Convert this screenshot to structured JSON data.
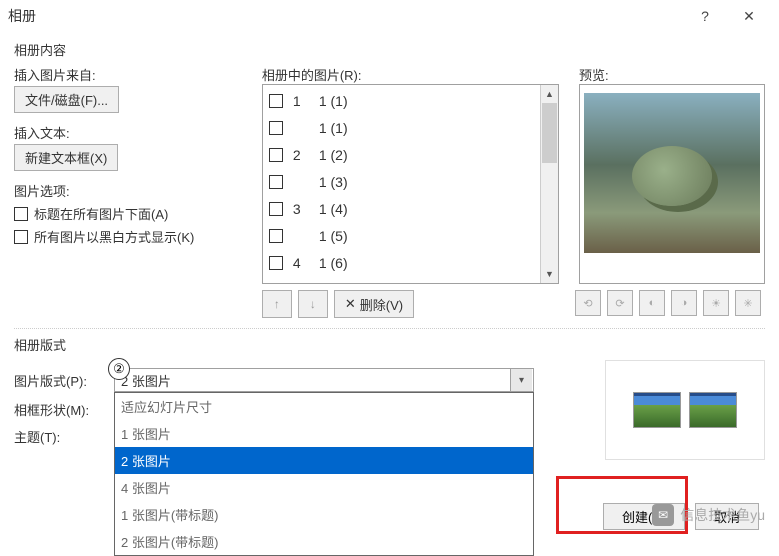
{
  "title": "相册",
  "help": "?",
  "close": "✕",
  "sections": {
    "content": "相册内容",
    "insert_from": "插入图片来自:",
    "file_disk": "文件/磁盘(F)...",
    "insert_text": "插入文本:",
    "new_textbox": "新建文本框(X)",
    "pic_options": "图片选项:",
    "opt_caption": "标题在所有图片下面(A)",
    "opt_bw": "所有图片以黑白方式显示(K)",
    "pics_in_album": "相册中的图片(R):",
    "preview": "预览:",
    "layout_section": "相册版式"
  },
  "list": [
    {
      "idx": "1",
      "label": "1 (1)"
    },
    {
      "idx": "",
      "label": "1 (1)"
    },
    {
      "idx": "2",
      "label": "1 (2)"
    },
    {
      "idx": "",
      "label": "1 (3)"
    },
    {
      "idx": "3",
      "label": "1 (4)"
    },
    {
      "idx": "",
      "label": "1 (5)"
    },
    {
      "idx": "4",
      "label": "1 (6)"
    }
  ],
  "below_list": {
    "remove": "删除(V)",
    "x": "✕"
  },
  "form": {
    "pic_layout_label": "图片版式(P):",
    "pic_layout_value": "2 张图片",
    "frame_shape_label": "相框形状(M):",
    "theme_label": "主题(T):"
  },
  "dropdown": {
    "items": [
      "适应幻灯片尺寸",
      "1 张图片",
      "2 张图片",
      "4 张图片",
      "1 张图片(带标题)",
      "2 张图片(带标题)"
    ],
    "selected_index": 2
  },
  "bottom": {
    "create": "创建(C)",
    "cancel": "取消"
  },
  "badge": "②",
  "watermark": "信息技术鱼yu"
}
